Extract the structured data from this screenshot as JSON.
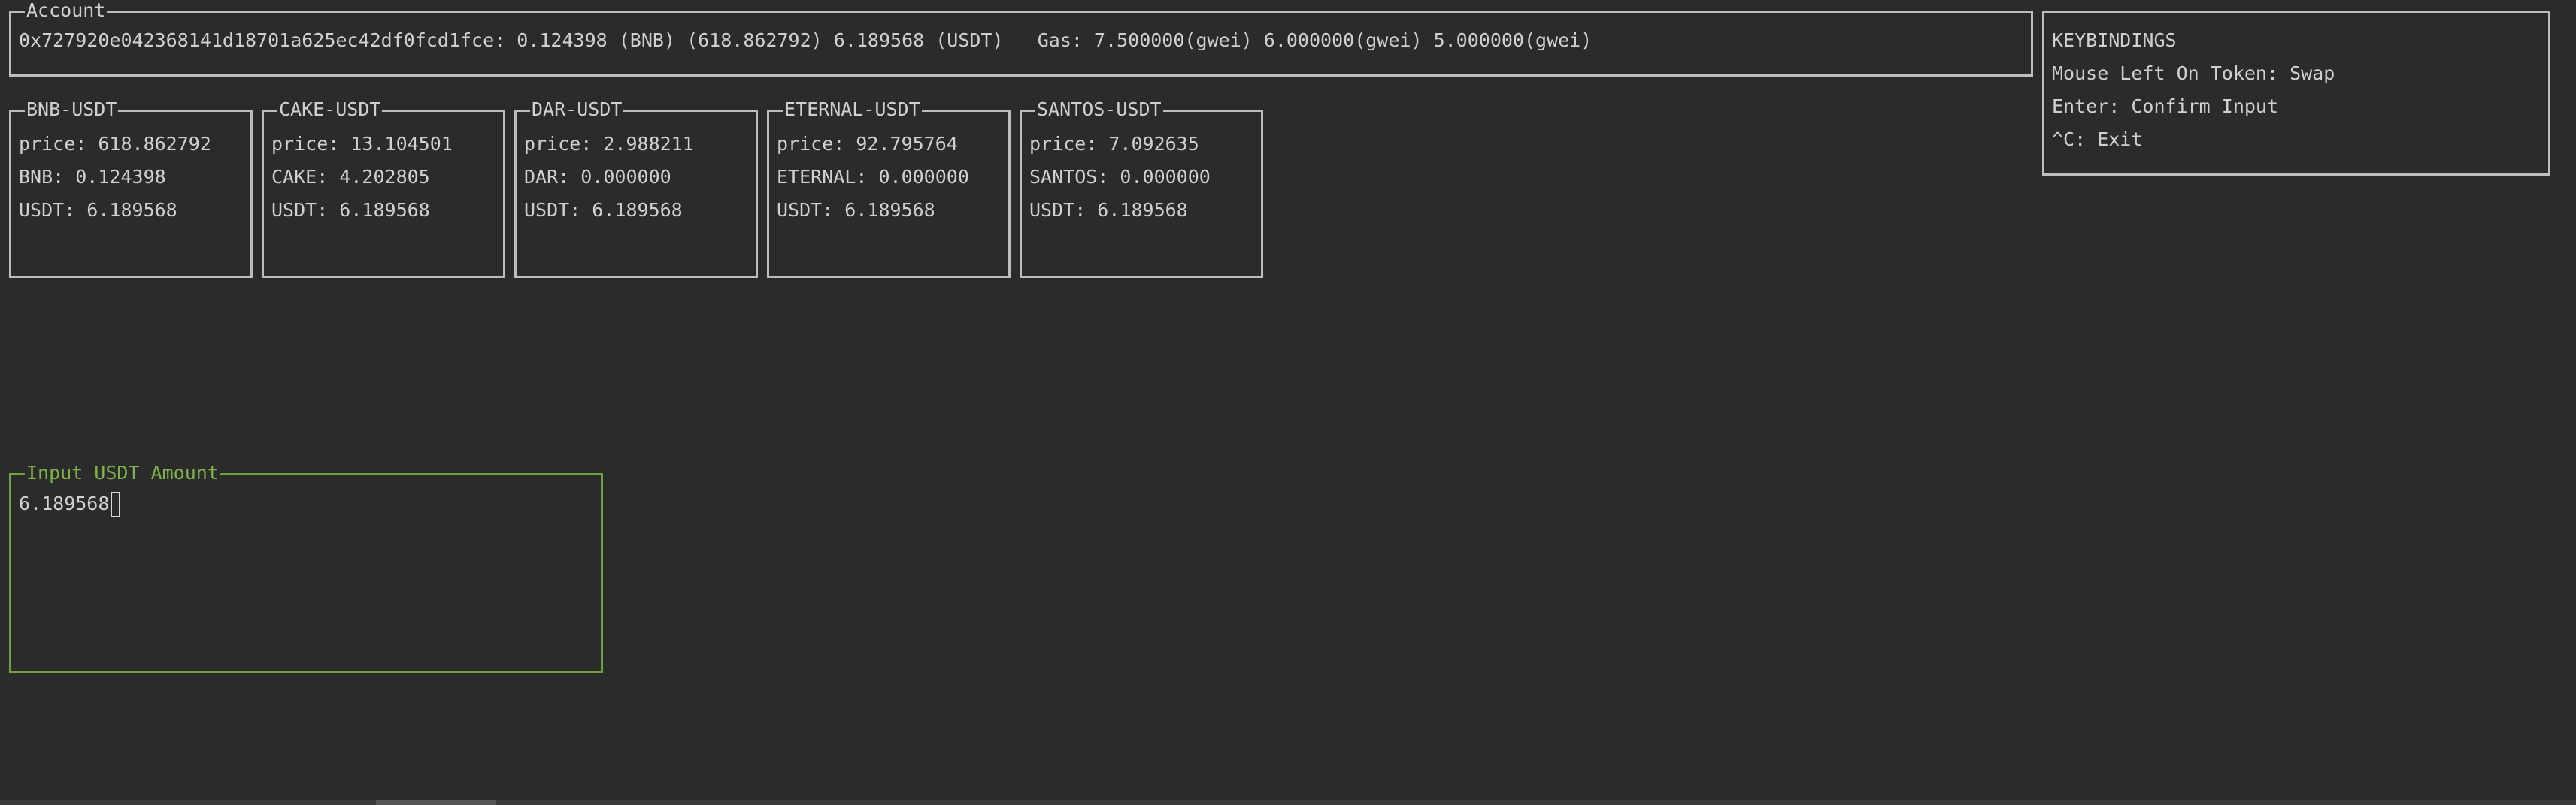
{
  "account": {
    "title": "Account",
    "address": "0x727920e042368141d18701a625ec42df0fcd1fce",
    "bnb_balance": "0.124398",
    "bnb_label": "(BNB)",
    "bnb_usd_value": "(618.862792)",
    "usdt_balance": "6.189568",
    "usdt_label": "(USDT)",
    "gas_label": "Gas:",
    "gas_values": [
      "7.500000(gwei)",
      "6.000000(gwei)",
      "5.000000(gwei)"
    ]
  },
  "keybindings": {
    "title": "KEYBINDINGS",
    "items": [
      "Mouse Left On Token: Swap",
      "Enter: Confirm Input",
      "^C: Exit"
    ]
  },
  "tokens": [
    {
      "title": "BNB-USDT",
      "price": "price: 618.862792",
      "balance": "BNB: 0.124398",
      "usdt": "USDT: 6.189568"
    },
    {
      "title": "CAKE-USDT",
      "price": "price: 13.104501",
      "balance": "CAKE: 4.202805",
      "usdt": "USDT: 6.189568"
    },
    {
      "title": "DAR-USDT",
      "price": "price: 2.988211",
      "balance": "DAR: 0.000000",
      "usdt": "USDT: 6.189568"
    },
    {
      "title": "ETERNAL-USDT",
      "price": "price: 92.795764",
      "balance": "ETERNAL: 0.000000",
      "usdt": "USDT: 6.189568"
    },
    {
      "title": "SANTOS-USDT",
      "price": "price: 7.092635",
      "balance": "SANTOS: 0.000000",
      "usdt": "USDT: 6.189568"
    }
  ],
  "input": {
    "title": "Input USDT Amount",
    "value": "6.189568"
  },
  "colors": {
    "background": "#2b2b2b",
    "border": "#bdbdbd",
    "text": "#d0d0d0",
    "input_border": "#6fa23a",
    "input_title": "#7fb24a"
  }
}
